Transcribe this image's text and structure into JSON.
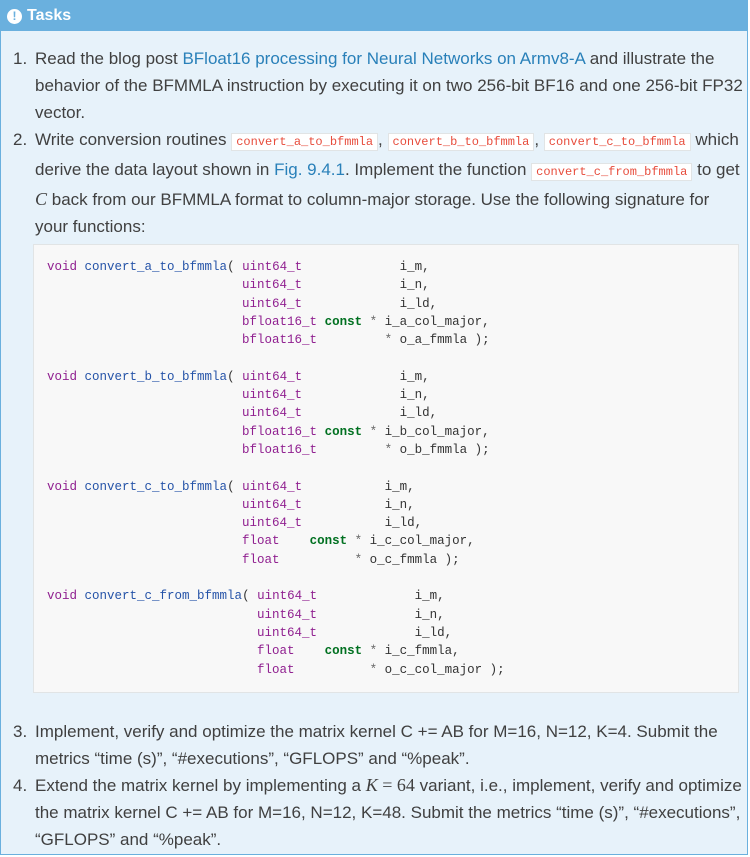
{
  "admonition": {
    "title": "Tasks",
    "icon": "info-icon"
  },
  "tasks": {
    "t1": {
      "pre": "Read the blog post ",
      "link": "BFloat16 processing for Neural Networks on Armv8-A",
      "post": " and illustrate the behavior of the BFMMLA instruction by executing it on two 256-bit BF16 and one 256-bit FP32 vector."
    },
    "t2": {
      "pre": "Write conversion routines ",
      "code1": "convert_a_to_bfmmla",
      "sep1": ", ",
      "code2": "convert_b_to_bfmmla",
      "sep2": ", ",
      "code3": "convert_c_to_bfmmla",
      "mid1": " which derive the data layout shown in ",
      "fig": "Fig. 9.4.1",
      "mid2": ". Implement the function ",
      "code4": "convert_c_from_bfmmla",
      "mid3": " to get ",
      "mathvar": "C",
      "post": " back from our BFMMLA format to column-major storage. Use the following signature for your functions:"
    },
    "t3": {
      "text": "Implement, verify and optimize the matrix kernel C += AB for M=16, N=12, K=4. Submit the metrics “time (s)”, “#executions”, “GFLOPS” and “%peak”."
    },
    "t4": {
      "pre": "Extend the matrix kernel by implementing a ",
      "math_var": "K",
      "math_eq": " = 64",
      "post": " variant, i.e., implement, verify and optimize the matrix kernel C += AB for M=16, N=12, K=48. Submit the metrics “time (s)”, “#executions”, “GFLOPS” and “%peak”."
    }
  },
  "code": {
    "void": "void",
    "fnA": "convert_a_to_bfmmla",
    "fnB": "convert_b_to_bfmmla",
    "fnC": "convert_c_to_bfmmla",
    "fnCf": "convert_c_from_bfmmla",
    "lp": "(",
    "u64": "uint64_t",
    "bf16": "bfloat16_t",
    "flt": "float",
    "cst": "const",
    "star": "*",
    "m": "i_m,",
    "n": "i_n,",
    "ld": "i_ld,",
    "acm": "i_a_col_major,",
    "oaf": "o_a_fmmla",
    "bcm": "i_b_col_major,",
    "obf": "o_b_fmmla",
    "ccm": "i_c_col_major,",
    "ocf": "o_c_fmmla",
    "icf": "i_c_fmmla,",
    "occm": "o_c_col_major",
    "end": " );"
  }
}
